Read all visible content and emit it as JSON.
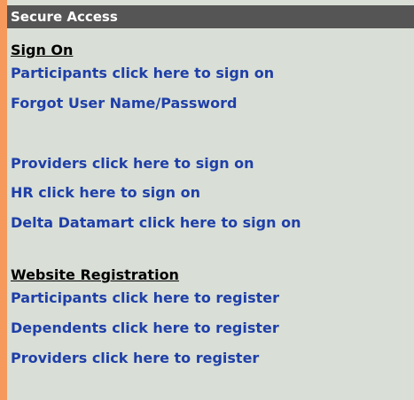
{
  "header": {
    "title": "Secure Access"
  },
  "sign_on": {
    "heading": "Sign On",
    "links": [
      "Participants click here to sign on",
      "Forgot User Name/Password",
      "Providers click here to sign on",
      "HR click here to sign on",
      "Delta Datamart click here to sign on"
    ]
  },
  "registration": {
    "heading": "Website Registration",
    "links": [
      "Participants click here to register",
      "Dependents click here to register",
      "Providers click here to register"
    ]
  },
  "colors": {
    "page_background": "#fbc3a0",
    "left_border": "#f59a5c",
    "panel_background": "#d9dfd6",
    "header_background": "#555555",
    "link": "#1f3fa8"
  }
}
